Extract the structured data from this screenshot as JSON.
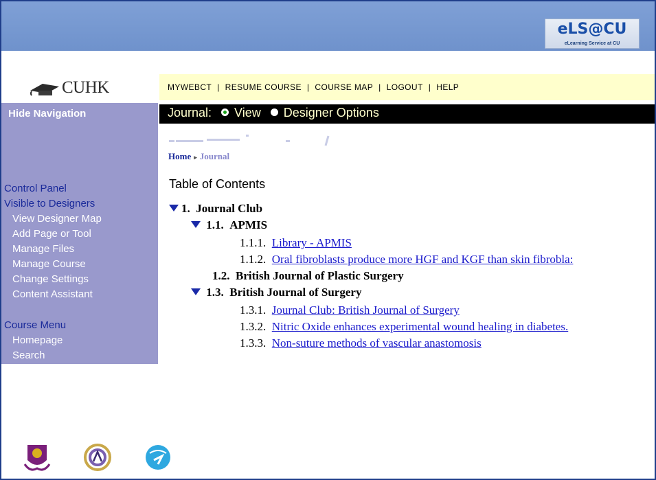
{
  "header": {
    "els_logo_text": "eLS@CU",
    "els_logo_subtext": "eLearning Service at CU"
  },
  "sidebar": {
    "logo_text": "CUHK",
    "hide_navigation": "Hide Navigation",
    "control_panel": "Control Panel",
    "visible_to_designers": "Visible to Designers",
    "designer_items": [
      "View Designer Map",
      "Add Page or Tool",
      "Manage Files",
      "Manage Course",
      "Change Settings",
      "Content Assistant"
    ],
    "course_menu": "Course Menu",
    "course_items": [
      "Homepage",
      "Search"
    ]
  },
  "menubar": {
    "items": [
      "MYWEBCT",
      "RESUME COURSE",
      "COURSE MAP",
      "LOGOUT",
      "HELP"
    ],
    "separator": "|"
  },
  "journalbar": {
    "label": "Journal:",
    "option_view": "View",
    "option_designer": "Designer Options",
    "selected": "View"
  },
  "breadcrumb": {
    "home": "Home",
    "current": "Journal"
  },
  "toc": {
    "title": "Table of Contents",
    "entries": [
      {
        "num": "1.",
        "label": "Journal Club"
      },
      {
        "num": "1.1.",
        "label": "APMIS"
      },
      {
        "num": "1.1.1.",
        "label": "Library - APMIS"
      },
      {
        "num": "1.1.2.",
        "label": "Oral fibroblasts produce more HGF and KGF than skin fibrobla:"
      },
      {
        "num": "1.2.",
        "label": "British Journal of Plastic Surgery"
      },
      {
        "num": "1.3.",
        "label": "British Journal of Surgery"
      },
      {
        "num": "1.3.1.",
        "label": "Journal Club: British Journal of Surgery"
      },
      {
        "num": "1.3.2.",
        "label": "Nitric Oxide enhances experimental wound healing in diabetes."
      },
      {
        "num": "1.3.3.",
        "label": "Non-suture methods of vascular anastomosis"
      }
    ]
  },
  "colors": {
    "top_band": "#7599d2",
    "sidebar": "#9999cc",
    "menubar": "#ffffcc",
    "journalbar": "#000000",
    "link": "#1a1acc"
  }
}
